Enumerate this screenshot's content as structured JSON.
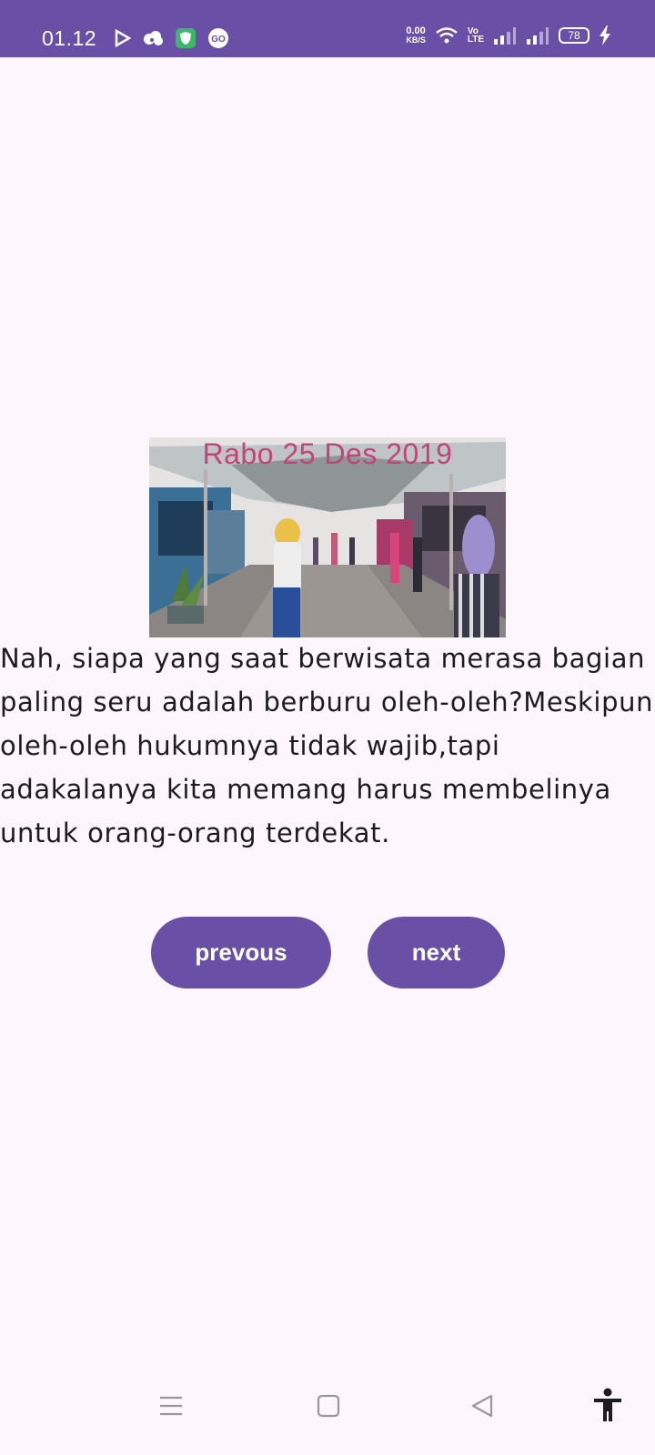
{
  "status_bar": {
    "time": "01.12",
    "net_speed_value": "0.00",
    "net_speed_unit": "KB/S",
    "volte_top": "Vo",
    "volte_bottom": "LTE",
    "battery_level": "78",
    "left_icons": [
      "play-store-icon",
      "cloud-app-icon",
      "shield-app-icon",
      "go-app-icon"
    ],
    "right_icons": [
      "wifi-icon",
      "signal-icon",
      "signal-icon",
      "charging-icon"
    ]
  },
  "photo": {
    "caption": "Rabo 25 Des 2019"
  },
  "content": {
    "paragraph": "Nah, siapa yang saat berwisata merasa bagian paling seru adalah berburu oleh-oleh?Meskipun oleh-oleh hukumnya tidak wajib,tapi adakalanya kita memang harus membelinya untuk orang-orang terdekat."
  },
  "buttons": {
    "previous_label": "prevous",
    "next_label": "next"
  },
  "colors": {
    "accent": "#6a4fa7",
    "background": "#fdf7fd",
    "caption": "#c2447a"
  },
  "nav_bar": {
    "icons": [
      "menu-icon",
      "home-icon",
      "back-icon",
      "accessibility-icon"
    ]
  }
}
